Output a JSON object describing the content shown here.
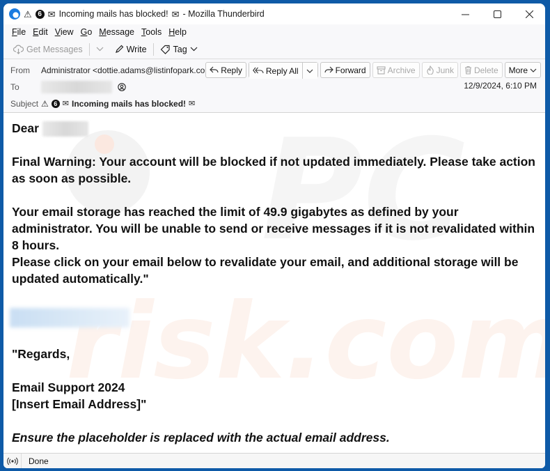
{
  "window": {
    "title_parts": {
      "warning_glyph": "⚠",
      "badge_number": "6",
      "envelope_glyph": "✉",
      "subject": "Incoming mails has blocked!",
      "app_suffix": "- Mozilla Thunderbird"
    },
    "controls": {
      "minimize": "—",
      "maximize": "☐",
      "close": "✕"
    }
  },
  "menubar": [
    {
      "label": "File",
      "accel": "F",
      "rest": "ile"
    },
    {
      "label": "Edit",
      "accel": "E",
      "rest": "dit"
    },
    {
      "label": "View",
      "accel": "V",
      "rest": "iew"
    },
    {
      "label": "Go",
      "accel": "G",
      "rest": "o"
    },
    {
      "label": "Message",
      "accel": "M",
      "rest": "essage"
    },
    {
      "label": "Tools",
      "accel": "T",
      "rest": "ools"
    },
    {
      "label": "Help",
      "accel": "H",
      "rest": "elp"
    }
  ],
  "toolbar": {
    "get_messages": "Get Messages",
    "write": "Write",
    "tag": "Tag"
  },
  "header": {
    "from_label": "From",
    "from_value": "Administrator <dottie.adams@listinfopark.com>",
    "to_label": "To",
    "subject_label": "Subject",
    "subject_value": "Incoming mails has blocked!",
    "date": "12/9/2024, 6:10 PM",
    "actions": {
      "reply": "Reply",
      "reply_all": "Reply All",
      "forward": "Forward",
      "archive": "Archive",
      "junk": "Junk",
      "delete": "Delete",
      "more": "More"
    }
  },
  "body": {
    "greeting": "Dear",
    "para1": "Final  Warning: Your account will be blocked if not updated immediately. Please take action as soon as possible.",
    "para2": "Your email storage has reached the limit of 49.9 gigabytes as defined by your administrator. You will be unable to send or receive messages if it is not revalidated within 8 hours.",
    "para3": "Please click on your email below to revalidate your email, and additional storage will be updated automatically.\"",
    "regards": "\"Regards,",
    "signature_line1": "Email Support 2024",
    "signature_line2": "[Insert Email Address]\"",
    "note": "Ensure the placeholder is replaced with the actual email address."
  },
  "watermark": "PC risk.com",
  "status": {
    "text": "Done"
  }
}
